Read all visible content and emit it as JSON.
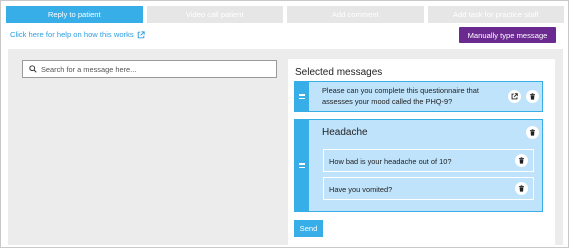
{
  "tabs": [
    {
      "label": "Reply to patient",
      "active": true
    },
    {
      "label": "Video call patient",
      "active": false
    },
    {
      "label": "Add comment",
      "active": false
    },
    {
      "label": "Add task for practice staff",
      "active": false
    }
  ],
  "help_link": {
    "label": "Click here for help on how this works",
    "icon": "external-link-icon"
  },
  "manual_button": {
    "label": "Manually type message"
  },
  "search": {
    "placeholder": "Search for a message here...",
    "value": "",
    "icon": "search-icon"
  },
  "selected": {
    "title": "Selected messages",
    "messages": [
      {
        "text": "Please can you complete this questionnaire that assesses your mood called the PHQ-9?",
        "icons": [
          "external-link-icon",
          "trash-icon"
        ]
      }
    ],
    "group": {
      "heading": "Headache",
      "items": [
        {
          "text": "How bad is your headache out of 10?"
        },
        {
          "text": "Have you vomited?"
        }
      ]
    },
    "send_label": "Send"
  },
  "colors": {
    "accent": "#38aee8",
    "card": "#bfe3fb",
    "manual_button": "#6b2a8f",
    "inactive_tab": "#e6e6e6",
    "panel_bg": "#ececec"
  }
}
